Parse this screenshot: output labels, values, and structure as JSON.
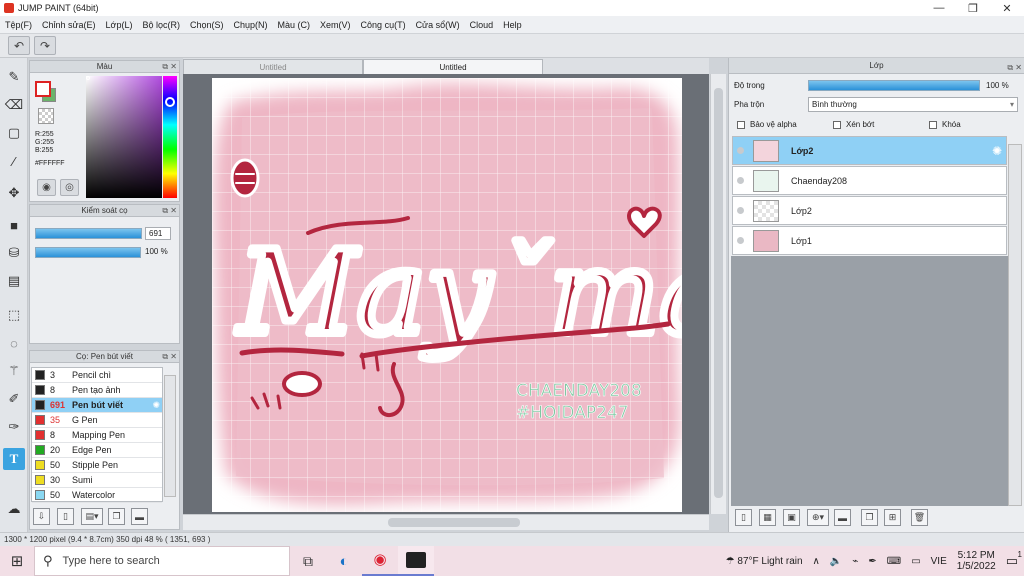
{
  "window": {
    "title": "JUMP PAINT (64bit)"
  },
  "menu": [
    "Tệp(F)",
    "Chỉnh sửa(E)",
    "Lớp(L)",
    "Bộ lọc(R)",
    "Chọn(S)",
    "Chụp(N)",
    "Màu (C)",
    "Xem(V)",
    "Công cụ(T)",
    "Cửa sổ(W)",
    "Cloud",
    "Help"
  ],
  "color_panel": {
    "title": "Màu",
    "r": "R:255",
    "g": "G:255",
    "b": "B:255",
    "hex": "#FFFFFF",
    "fg_color": "#ffffff",
    "bg_color": "#6bb36b"
  },
  "brush_control": {
    "title": "Kiểm soát cọ",
    "size": "691",
    "opacity": "100 %"
  },
  "brush_panel": {
    "title": "Cọ: Pen bút viết",
    "items": [
      {
        "size": "3",
        "name": "Pencil chì",
        "color": "#222222"
      },
      {
        "size": "8",
        "name": "Pen tạo ảnh",
        "color": "#222222"
      },
      {
        "size": "691",
        "name": "Pen bút viết",
        "color": "#222222"
      },
      {
        "size": "35",
        "name": "G Pen",
        "color": "#e23030"
      },
      {
        "size": "8",
        "name": "Mapping Pen",
        "color": "#e23030"
      },
      {
        "size": "20",
        "name": "Edge Pen",
        "color": "#22aa22"
      },
      {
        "size": "50",
        "name": "Stipple Pen",
        "color": "#eedd22"
      },
      {
        "size": "30",
        "name": "Sumi",
        "color": "#eedd22"
      },
      {
        "size": "50",
        "name": "Watercolor",
        "color": "#8ad8f2"
      }
    ]
  },
  "tabs": [
    "Untitled",
    "Untitled"
  ],
  "artwork": {
    "main_text": "Mayˇmắn",
    "credit_1": "CHAENDAY208",
    "credit_2": "#HOIDAP247"
  },
  "layer_panel": {
    "title": "Lớp",
    "opacity_label": "Độ trong",
    "opacity_value": "100 %",
    "blend_label": "Pha trộn",
    "blend_value": "Bình thường",
    "protect_alpha": "Bảo vệ alpha",
    "clip": "Xén bớt",
    "lock": "Khóa",
    "layers": [
      "Lớp2",
      "Chaenday208",
      "Lớp2",
      "Lớp1"
    ]
  },
  "status": {
    "info": "1300 * 1200 pixel  (9.4 * 8.7cm)  350 dpi  48 %  ( 1351, 693 )"
  },
  "taskbar": {
    "search_placeholder": "Type here to search",
    "weather": "87°F  Light rain",
    "lang": "VIE",
    "time": "5:12 PM",
    "date": "1/5/2022",
    "notif_count": "1"
  }
}
